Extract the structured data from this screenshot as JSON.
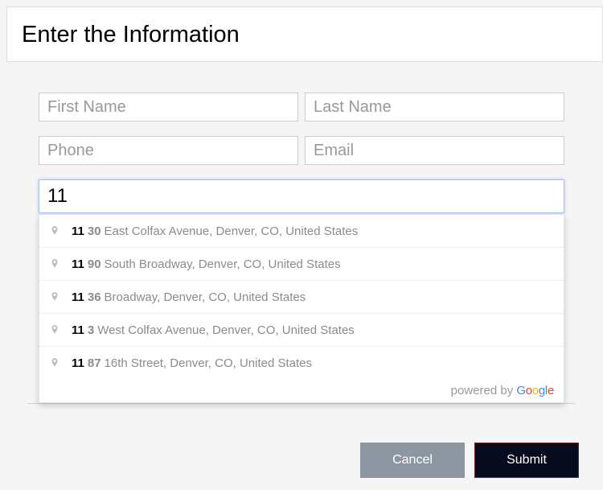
{
  "header": {
    "title": "Enter the Information"
  },
  "fields": {
    "first_name": {
      "placeholder": "First Name",
      "value": ""
    },
    "last_name": {
      "placeholder": "Last Name",
      "value": ""
    },
    "phone": {
      "placeholder": "Phone",
      "value": ""
    },
    "email": {
      "placeholder": "Email",
      "value": ""
    },
    "address": {
      "placeholder": "",
      "value": "11"
    }
  },
  "suggestions": [
    {
      "match": "11",
      "rest_bold": "30",
      "rest": "East Colfax Avenue, Denver, CO, United States"
    },
    {
      "match": "11",
      "rest_bold": "90",
      "rest": "South Broadway, Denver, CO, United States"
    },
    {
      "match": "11",
      "rest_bold": "36",
      "rest": "Broadway, Denver, CO, United States"
    },
    {
      "match": "11",
      "rest_bold": "3",
      "rest": "West Colfax Avenue, Denver, CO, United States"
    },
    {
      "match": "11",
      "rest_bold": "87",
      "rest": "16th Street, Denver, CO, United States"
    }
  ],
  "powered_by": {
    "prefix": "powered by ",
    "brand": "Google"
  },
  "buttons": {
    "cancel": "Cancel",
    "submit": "Submit"
  }
}
